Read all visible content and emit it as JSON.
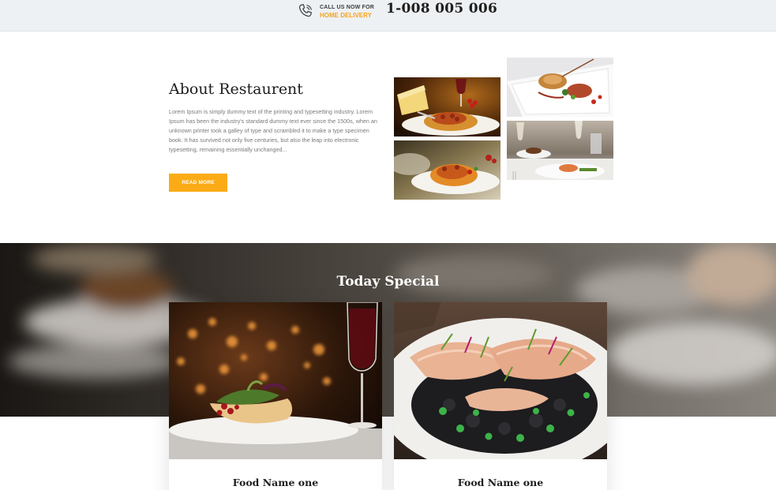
{
  "topbar": {
    "call_line1": "CALL US NOW FOR",
    "call_line2": "HOME DELIVERY",
    "phone": "1-008 005 006",
    "icon": "phone-icon",
    "accent_color": "#f7a21d"
  },
  "about": {
    "title": "About Restaurent",
    "text": "Lorem Ipsum is simply dummy text of the printing and typesetting industry. Lorem Ipsum has been the industry's standard dummy text ever since the 1500s, when an unknown printer took a galley of type and scrambled it to make a type specimen book. It has survived not only five centuries, but also the leap into electronic typesetting, remaining essentially unchanged...",
    "button_label": "READ MORE",
    "button_color": "#fbab15"
  },
  "special": {
    "title": "Today Special",
    "cards": [
      {
        "name": "Food Name one"
      },
      {
        "name": "Food Name one"
      }
    ]
  }
}
